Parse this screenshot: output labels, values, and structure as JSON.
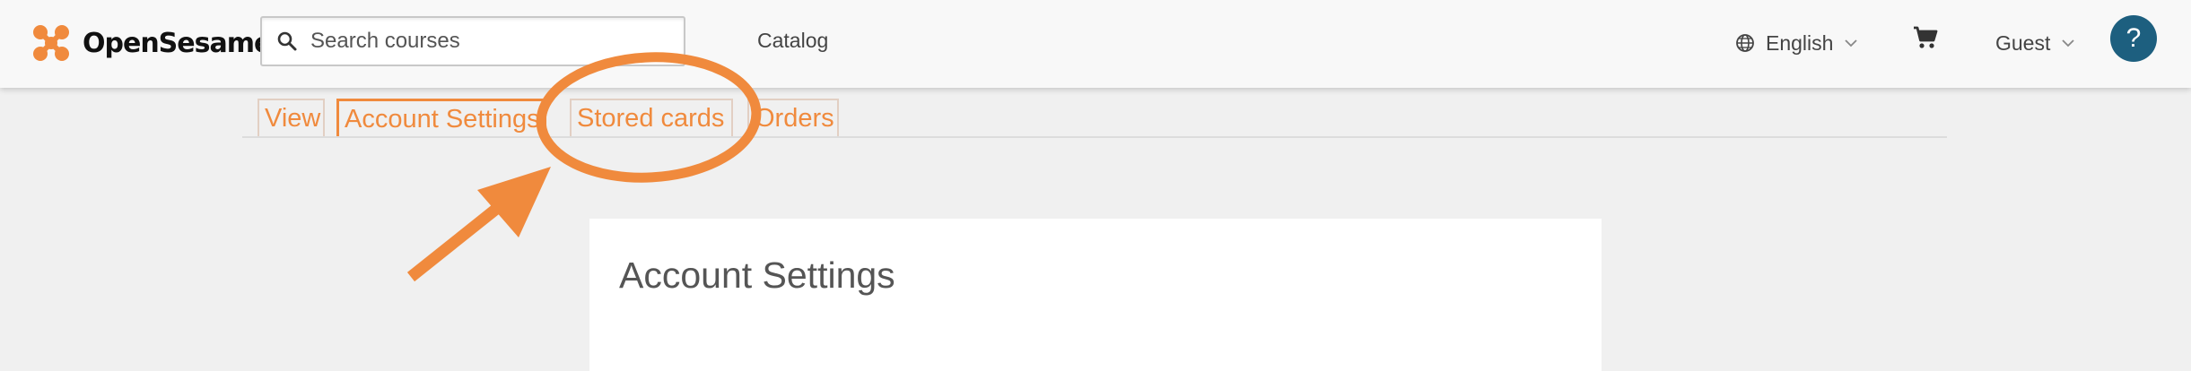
{
  "header": {
    "logo_text": "OpenSesame",
    "search": {
      "placeholder": "Search courses",
      "value": ""
    },
    "catalog_label": "Catalog",
    "language_label": "English",
    "user_label": "Guest",
    "help_label": "?"
  },
  "tabs": [
    {
      "label": "View"
    },
    {
      "label": "Account Settings",
      "active": true
    },
    {
      "label": "Stored cards"
    },
    {
      "label": "Orders"
    }
  ],
  "main": {
    "title": "Account Settings"
  },
  "colors": {
    "accent": "#f08a3d",
    "help": "#1d5f7f"
  },
  "icons": [
    "opensesame-logo-icon",
    "search-icon",
    "globe-icon",
    "chevron-down-icon",
    "cart-icon",
    "help-icon"
  ]
}
